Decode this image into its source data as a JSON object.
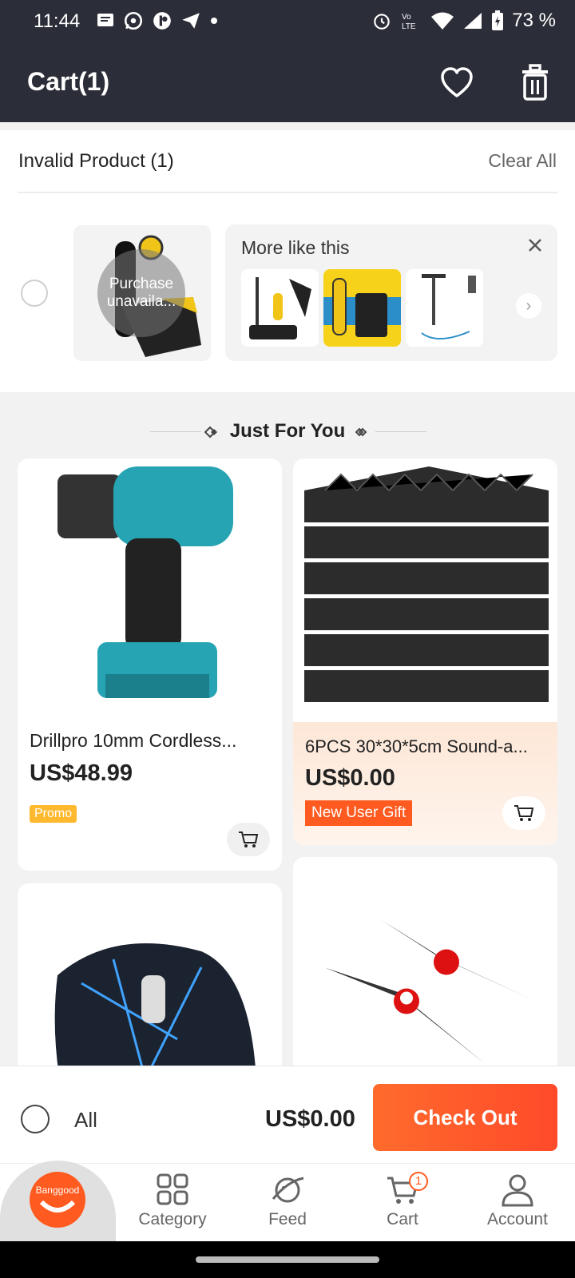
{
  "status_bar": {
    "time": "11:44",
    "battery": "73 %",
    "left_icons": [
      "message-icon",
      "whatsapp-icon",
      "app-icon",
      "telegram-icon",
      "dot-icon"
    ],
    "right_icons": [
      "alarm-icon",
      "volte-icon",
      "wifi-icon",
      "signal-icon",
      "battery-icon"
    ]
  },
  "header": {
    "title": "Cart(1)",
    "icons": [
      "heart-icon",
      "trash-icon"
    ]
  },
  "invalid_section": {
    "title": "Invalid Product (1)",
    "clear_all": "Clear All",
    "overlay_line1": "Purchase",
    "overlay_line2": "unavaila...",
    "more_like_this": "More like this",
    "arrow": "›"
  },
  "just_for_you": {
    "title": "Just For You"
  },
  "products": [
    {
      "name": "Drillpro 10mm Cordless...",
      "price": "US$48.99",
      "badge": "Promo"
    },
    {
      "name": "6PCS 30*30*5cm Sound-a...",
      "price": "US$0.00",
      "badge": "New User Gift"
    }
  ],
  "checkout": {
    "all_label": "All",
    "total": "US$0.00",
    "button": "Check Out"
  },
  "bottom_nav": {
    "home_logo": "Banggood",
    "items": [
      {
        "label": "Category",
        "icon": "grid-icon"
      },
      {
        "label": "Feed",
        "icon": "planet-icon"
      },
      {
        "label": "Cart",
        "icon": "cart-icon",
        "badge": "1"
      },
      {
        "label": "Account",
        "icon": "person-icon"
      }
    ]
  },
  "colors": {
    "header_bg": "#2b2d38",
    "accent": "#ff5a1f",
    "promo": "#ffb92e"
  }
}
